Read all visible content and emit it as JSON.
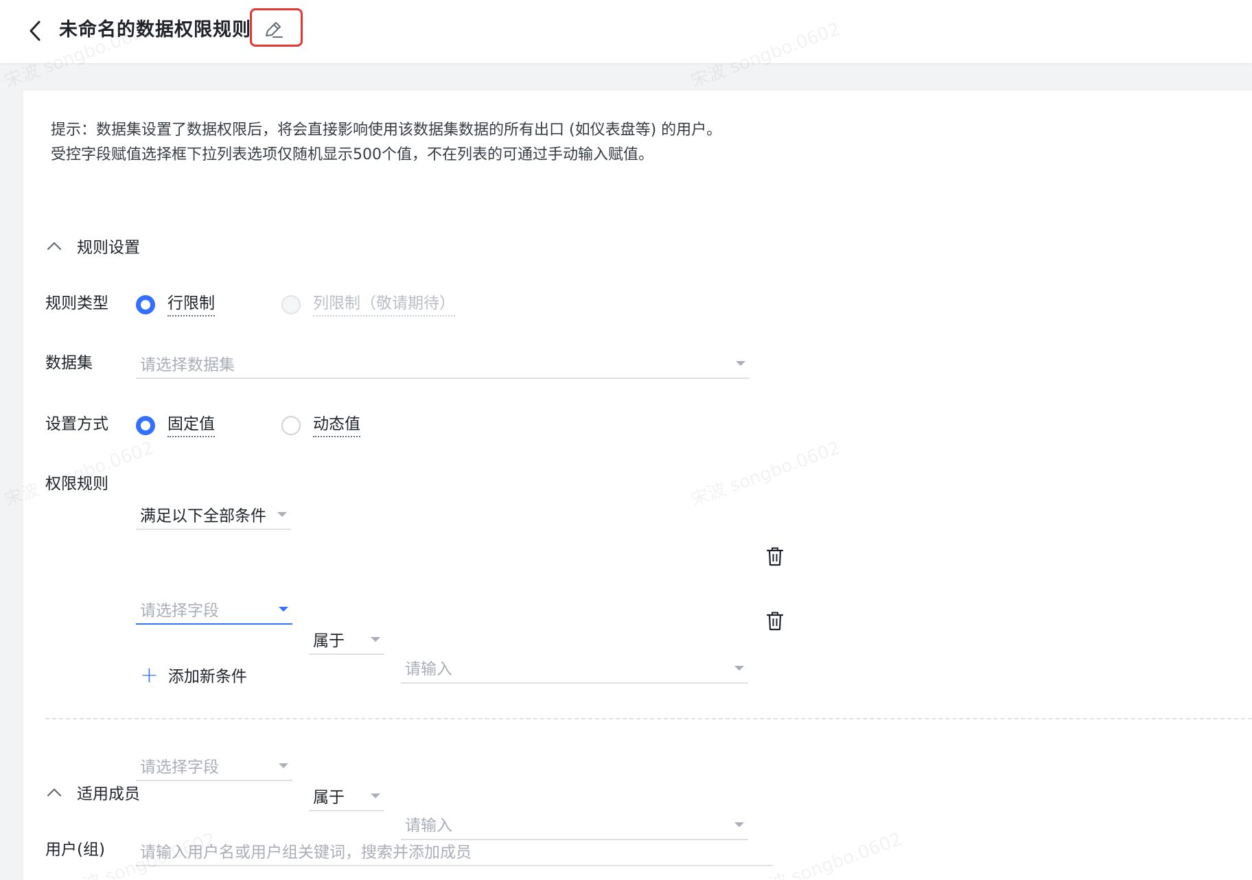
{
  "header": {
    "title": "未命名的数据权限规则"
  },
  "tip": "提示：数据集设置了数据权限后，将会直接影响使用该数据集数据的所有出口 (如仪表盘等) 的用户。 受控字段赋值选择框下拉列表选项仅随机显示500个值，不在列表的可通过手动输入赋值。",
  "rule_section": {
    "title": "规则设置",
    "rule_type": {
      "label": "规则类型",
      "options": [
        "行限制",
        "列限制（敬请期待）"
      ]
    },
    "dataset": {
      "label": "数据集",
      "placeholder": "请选择数据集"
    },
    "set_mode": {
      "label": "设置方式",
      "options": [
        "固定值",
        "动态值"
      ]
    },
    "permission_rule": {
      "label": "权限规则",
      "value": "满足以下全部条件"
    },
    "conditions": [
      {
        "field_placeholder": "请选择字段",
        "operator": "属于",
        "value_placeholder": "请输入"
      },
      {
        "field_placeholder": "请选择字段",
        "operator": "属于",
        "value_placeholder": "请输入"
      }
    ],
    "add_condition": "添加新条件"
  },
  "members_section": {
    "title": "适用成员",
    "user_label": "用户(组)",
    "user_placeholder": "请输入用户名或用户组关键词，搜索并添加成员"
  },
  "watermark": "宋波 songbo.0602",
  "colors": {
    "accent": "#3370ff",
    "highlight_box": "#e5372f"
  }
}
